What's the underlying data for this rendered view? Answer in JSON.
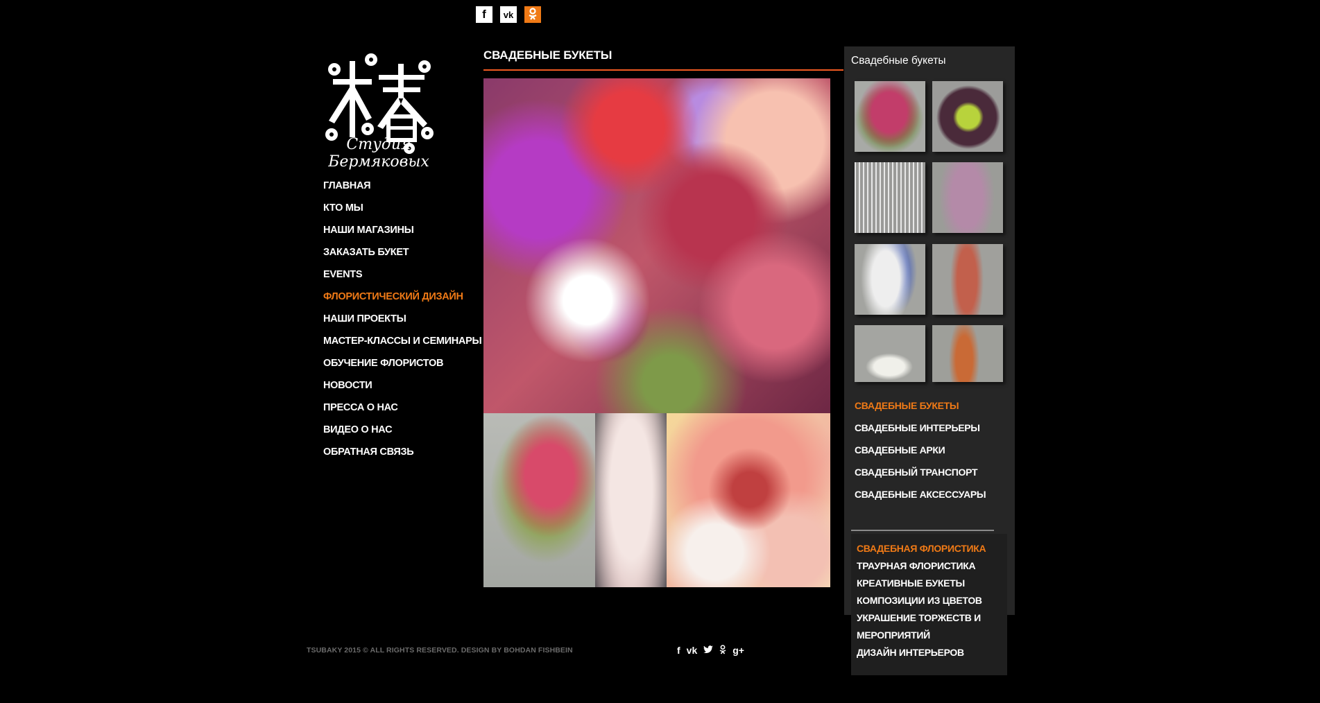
{
  "top_social": [
    {
      "name": "facebook",
      "glyph": "f"
    },
    {
      "name": "vkontakte",
      "glyph": "vk"
    },
    {
      "name": "odnoklassniki",
      "glyph": "ok"
    }
  ],
  "logo": {
    "caption": "Студия Бермяковых"
  },
  "main_nav": [
    {
      "label": "ГЛАВНАЯ",
      "active": false
    },
    {
      "label": "КТО МЫ",
      "active": false
    },
    {
      "label": "НАШИ МАГАЗИНЫ",
      "active": false
    },
    {
      "label": "ЗАКАЗАТЬ БУКЕТ",
      "active": false
    },
    {
      "label": "EVENTS",
      "active": false
    },
    {
      "label": "ФЛОРИСТИЧЕСКИЙ ДИЗАЙН",
      "active": true
    },
    {
      "label": "НАШИ ПРОЕКТЫ",
      "active": false
    },
    {
      "label": "МАСТЕР-КЛАССЫ И СЕМИНАРЫ",
      "active": false
    },
    {
      "label": "ОБУЧЕНИЕ ФЛОРИСТОВ",
      "active": false
    },
    {
      "label": "НОВОСТИ",
      "active": false
    },
    {
      "label": "ПРЕССА О НАС",
      "active": false
    },
    {
      "label": "ВИДЕО О НАС",
      "active": false
    },
    {
      "label": "ОБРАТНАЯ СВЯЗЬ",
      "active": false
    }
  ],
  "main": {
    "title": "СВАДЕБНЫЕ БУКЕТЫ"
  },
  "gallery": {
    "title": "Свадебные букеты"
  },
  "sub_nav": [
    {
      "label": "СВАДЕБНЫЕ БУКЕТЫ",
      "active": true
    },
    {
      "label": "СВАДЕБНЫЕ ИНТЕРЬЕРЫ",
      "active": false
    },
    {
      "label": "СВАДЕБНЫЕ АРКИ",
      "active": false
    },
    {
      "label": "СВАДЕБНЫЙ ТРАНСПОРТ",
      "active": false
    },
    {
      "label": "СВАДЕБНЫЕ АКСЕССУАРЫ",
      "active": false
    }
  ],
  "floristry_nav": [
    {
      "label": "СВАДЕБНАЯ ФЛОРИСТИКА",
      "active": true
    },
    {
      "label": "ТРАУРНАЯ ФЛОРИСТИКА",
      "active": false
    },
    {
      "label": "КРЕАТИВНЫЕ БУКЕТЫ",
      "active": false
    },
    {
      "label": "КОМПОЗИЦИИ ИЗ ЦВЕТОВ",
      "active": false
    },
    {
      "label": "УКРАШЕНИЕ ТОРЖЕСТВ И МЕРОПРИЯТИЙ",
      "active": false
    },
    {
      "label": "ДИЗАЙН ИНТЕРЬЕРОВ",
      "active": false
    }
  ],
  "footer": {
    "copyright": "TSUBAKY 2015 © ALL RIGHTS RESERVED. DESIGN BY BOHDAN FISHBEIN",
    "social": [
      "f",
      "vk",
      "twitter",
      "ok",
      "g+"
    ]
  },
  "colors": {
    "accent": "#f07a16",
    "rule": "#f05a22",
    "panel": "#262626"
  }
}
